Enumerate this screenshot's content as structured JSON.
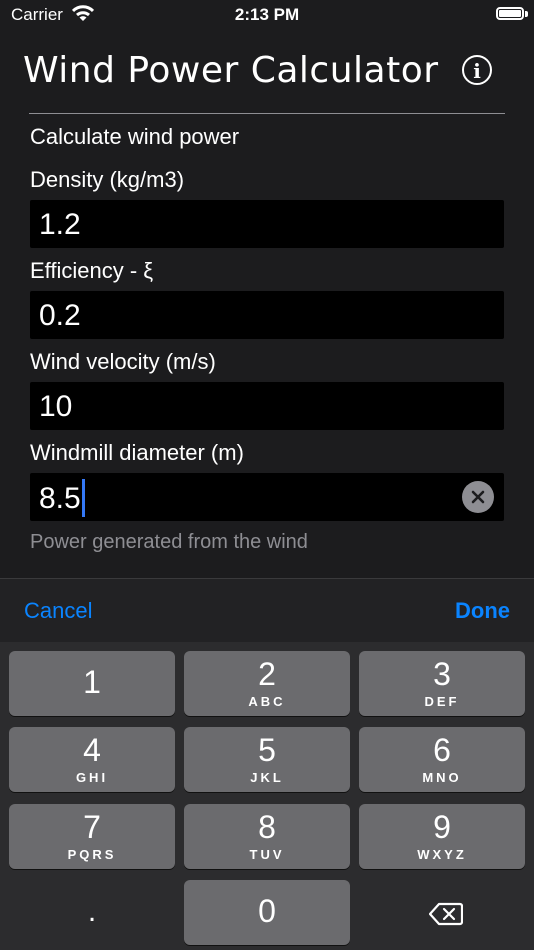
{
  "status_bar": {
    "carrier": "Carrier",
    "time": "2:13 PM"
  },
  "header": {
    "title": "Wind Power Calculator",
    "info_icon": "info-circle-icon"
  },
  "form": {
    "section_title": "Calculate wind power",
    "fields": [
      {
        "label": "Density (kg/m3)",
        "value": "1.2"
      },
      {
        "label": "Efficiency - ξ",
        "value": "0.2"
      },
      {
        "label": "Wind velocity (m/s)",
        "value": "10"
      },
      {
        "label": "Windmill diameter (m)",
        "value": "8.5"
      }
    ],
    "helper": "Power generated from the wind"
  },
  "toolbar": {
    "cancel": "Cancel",
    "done": "Done",
    "accent": "#0a84ff"
  },
  "keypad": {
    "keys": [
      {
        "num": "1",
        "letters": ""
      },
      {
        "num": "2",
        "letters": "ABC"
      },
      {
        "num": "3",
        "letters": "DEF"
      },
      {
        "num": "4",
        "letters": "GHI"
      },
      {
        "num": "5",
        "letters": "JKL"
      },
      {
        "num": "6",
        "letters": "MNO"
      },
      {
        "num": "7",
        "letters": "PQRS"
      },
      {
        "num": "8",
        "letters": "TUV"
      },
      {
        "num": "9",
        "letters": "WXYZ"
      },
      {
        "num": "0",
        "letters": ""
      }
    ],
    "decimal": ".",
    "delete_icon": "backspace-icon"
  }
}
